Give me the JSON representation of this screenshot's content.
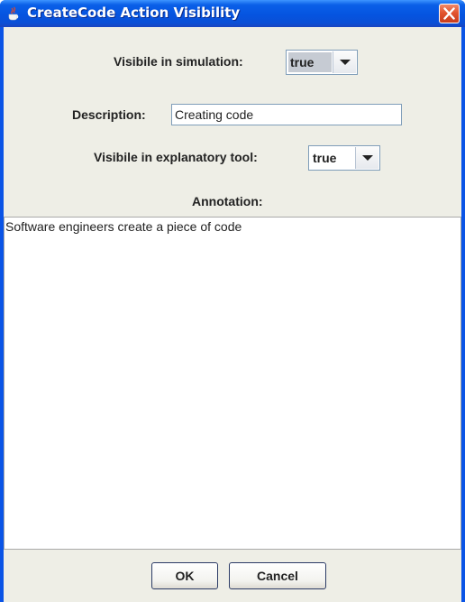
{
  "window": {
    "title": "CreateCode Action Visibility",
    "title_icon": "java-cup-icon",
    "close_icon": "close-icon"
  },
  "form": {
    "sim_label": "Visibile in simulation:",
    "sim_value": "true",
    "desc_label": "Description:",
    "desc_value": "Creating code",
    "expl_label": "Visibile in explanatory tool:",
    "expl_value": "true",
    "annotation_label": "Annotation:",
    "annotation_text": "Software engineers create a piece of code"
  },
  "buttons": {
    "ok": "OK",
    "cancel": "Cancel"
  },
  "colors": {
    "titlebar": "#0554e0",
    "client": "#eeeee6",
    "close": "#e2542f",
    "selected_combo": "#c6cbd3"
  }
}
